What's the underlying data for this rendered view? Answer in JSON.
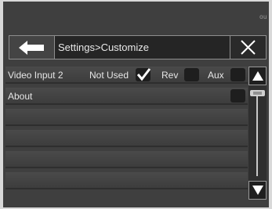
{
  "corner_text": "ou",
  "header": {
    "breadcrumb": "Settings>Customize"
  },
  "rows": [
    {
      "label": "Video Input 2",
      "options": [
        {
          "label": "Not Used",
          "checked": true
        },
        {
          "label": "Rev",
          "checked": false
        },
        {
          "label": "Aux",
          "checked": false
        }
      ]
    },
    {
      "label": "About",
      "checked": false
    }
  ],
  "icons": {
    "back": "arrow-left-icon",
    "close": "close-icon",
    "scroll_up": "triangle-up-icon",
    "scroll_down": "triangle-down-icon",
    "scroll_thumb": "grip-lines-icon"
  },
  "colors": {
    "background": "#3f3f3f",
    "text": "#e6e6e6",
    "checkbox": "#1e1e1e"
  }
}
